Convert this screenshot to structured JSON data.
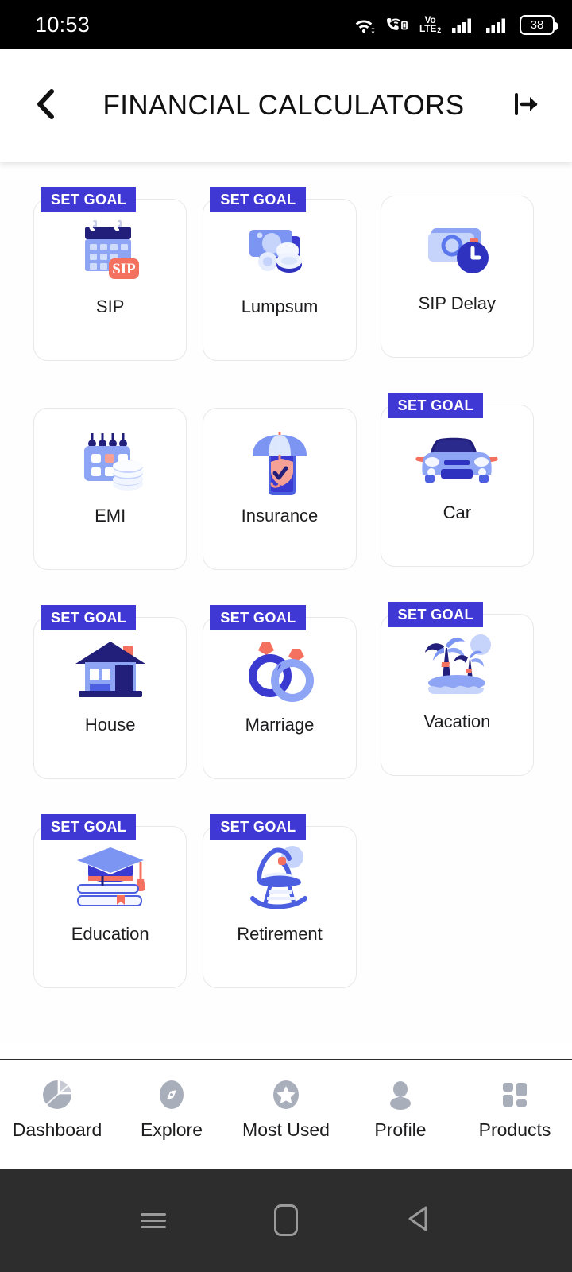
{
  "status_bar": {
    "time": "10:53",
    "battery_level": "38",
    "volte_top": "Vo",
    "volte_bottom": "LTE",
    "volte_sim": "2",
    "icons": [
      "wifi-icon",
      "call-over-wifi-icon",
      "volte-indicator",
      "signal-icon-1",
      "signal-icon-2",
      "battery-icon"
    ]
  },
  "header": {
    "title": "FINANCIAL CALCULATORS",
    "back_icon": "back-chevron-icon",
    "logout_icon": "logout-icon"
  },
  "colors": {
    "badge_bg": "#4038d4",
    "badge_text": "#ffffff",
    "card_border": "#e8e8ea",
    "icon_primary": "#4b5fe0",
    "icon_light": "#8ea4f5",
    "icon_pale": "#c6d4fb",
    "icon_dark": "#211f7a",
    "accent_red": "#f4705f",
    "nav_icon": "#a9aebb",
    "status_bg": "#000000",
    "android_nav_bg": "#2d2d2d"
  },
  "badge_label": "SET GOAL",
  "calculators": [
    {
      "label": "SIP",
      "icon": "calendar-sip-icon",
      "has_goal": true,
      "raised": false
    },
    {
      "label": "Lumpsum",
      "icon": "money-coins-icon",
      "has_goal": true,
      "raised": false
    },
    {
      "label": "SIP Delay",
      "icon": "wallet-clock-icon",
      "has_goal": false,
      "raised": true
    },
    {
      "label": "EMI",
      "icon": "calendar-coins-icon",
      "has_goal": false,
      "raised": false
    },
    {
      "label": "Insurance",
      "icon": "umbrella-shield-icon",
      "has_goal": false,
      "raised": false
    },
    {
      "label": "Car",
      "icon": "car-icon",
      "has_goal": true,
      "raised": true
    },
    {
      "label": "House",
      "icon": "house-icon",
      "has_goal": true,
      "raised": false
    },
    {
      "label": "Marriage",
      "icon": "rings-icon",
      "has_goal": true,
      "raised": false
    },
    {
      "label": "Vacation",
      "icon": "palm-island-icon",
      "has_goal": true,
      "raised": true
    },
    {
      "label": "Education",
      "icon": "graduation-books-icon",
      "has_goal": true,
      "raised": false
    },
    {
      "label": "Retirement",
      "icon": "rocking-chair-icon",
      "has_goal": true,
      "raised": false
    }
  ],
  "bottom_nav": [
    {
      "label": "Dashboard",
      "icon": "pie-chart-icon"
    },
    {
      "label": "Explore",
      "icon": "compass-icon"
    },
    {
      "label": "Most Used",
      "icon": "star-icon"
    },
    {
      "label": "Profile",
      "icon": "person-icon"
    },
    {
      "label": "Products",
      "icon": "grid-icon"
    }
  ],
  "android_nav": [
    {
      "icon": "recents-icon"
    },
    {
      "icon": "home-icon"
    },
    {
      "icon": "back-triangle-icon"
    }
  ]
}
